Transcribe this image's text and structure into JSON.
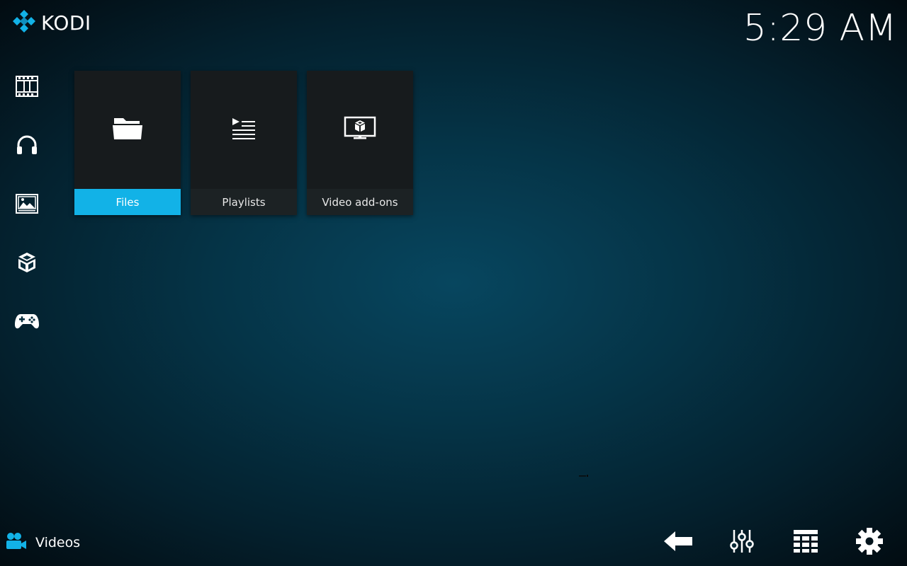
{
  "app": {
    "logo_text": "KODI",
    "clock": "5:29 AM"
  },
  "sidebar": {
    "items": [
      {
        "name": "movies",
        "icon": "film-icon"
      },
      {
        "name": "music",
        "icon": "headphones-icon"
      },
      {
        "name": "pictures",
        "icon": "picture-icon"
      },
      {
        "name": "addons",
        "icon": "box-icon"
      },
      {
        "name": "games",
        "icon": "gamepad-icon"
      }
    ]
  },
  "main": {
    "tiles": [
      {
        "label": "Files",
        "icon": "folder-icon",
        "selected": true
      },
      {
        "label": "Playlists",
        "icon": "playlist-icon",
        "selected": false
      },
      {
        "label": "Video add-ons",
        "icon": "monitor-box-icon",
        "selected": false
      }
    ]
  },
  "footer": {
    "section_title": "Videos",
    "section_icon": "camera-people-icon",
    "buttons": [
      {
        "name": "back",
        "icon": "arrow-left-icon"
      },
      {
        "name": "options",
        "icon": "sliders-icon"
      },
      {
        "name": "view",
        "icon": "grid-icon"
      },
      {
        "name": "settings",
        "icon": "gear-icon"
      }
    ]
  },
  "colors": {
    "accent": "#12b2e7",
    "tile_bg": "#171b1d",
    "background_center": "#07465f"
  }
}
